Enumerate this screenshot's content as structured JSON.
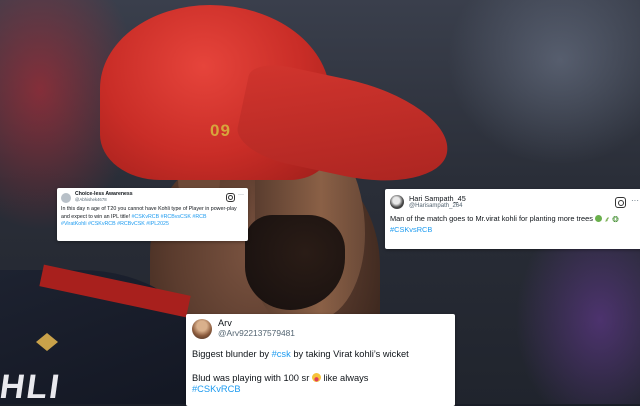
{
  "photo": {
    "cap_number": "09",
    "jersey_letters": "HLI"
  },
  "tweets": [
    {
      "name": "Choice-less Awareness",
      "handle": "@Abhishek4678",
      "text": "In this day n age of T20 you cannot have Kohli type of Player in power-play and expect to win an IPL title!",
      "hashtags_line1": "#CSKvRCB #RCBvsCSK #RCB",
      "hashtags_line2": "#ViratKohli #CSKvRCB #RCBvCSK #IPL2025",
      "icons": [
        "instagram-icon",
        "more-icon"
      ]
    },
    {
      "name": "Hari Sampath_45",
      "handle": "@Harisampath_264",
      "text": "Man of the match goes to Mr.virat kohli for planting more trees",
      "emojis": [
        "green-circle",
        "seedling",
        "palm-tree"
      ],
      "hashtags": "#CSKvsRCB",
      "icons": [
        "instagram-icon",
        "more-icon"
      ]
    },
    {
      "name": "Arv",
      "handle": "@Arv922137579481",
      "line1_prefix": "Biggest blunder by",
      "line1_tag": "#csk",
      "line1_suffix": "by taking Virat kohli’s wicket",
      "line2": "Blud was playing with 100 sr",
      "line2_suffix": "like always",
      "hashtags": "#CSKvRCB"
    }
  ],
  "colors": {
    "link": "#1d9bf0",
    "text": "#0f1419",
    "muted": "#536471",
    "cap_red": "#c92d27"
  }
}
